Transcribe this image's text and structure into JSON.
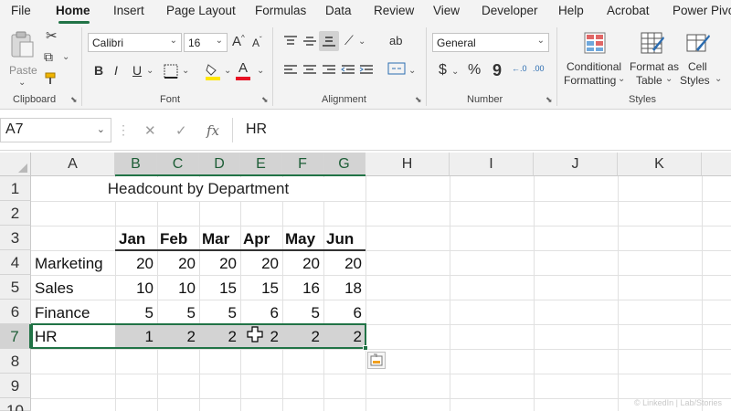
{
  "ribbon_tabs": [
    {
      "label": "File"
    },
    {
      "label": "Home"
    },
    {
      "label": "Insert"
    },
    {
      "label": "Page Layout"
    },
    {
      "label": "Formulas"
    },
    {
      "label": "Data"
    },
    {
      "label": "Review"
    },
    {
      "label": "View"
    },
    {
      "label": "Developer"
    },
    {
      "label": "Help"
    },
    {
      "label": "Acrobat"
    },
    {
      "label": "Power Pivot"
    }
  ],
  "active_tab": "Home",
  "clipboard": {
    "paste_label": "Paste",
    "group_label": "Clipboard"
  },
  "font": {
    "name": "Calibri",
    "size": "16",
    "group_label": "Font",
    "bold": "B",
    "italic": "I",
    "underline": "U",
    "grow": "A",
    "shrink": "A",
    "font_color_glyph": "A",
    "highlight_color": "#ffe600",
    "font_color": "#e81123"
  },
  "alignment": {
    "group_label": "Alignment",
    "wrap_glyph": "ab"
  },
  "number": {
    "format": "General",
    "group_label": "Number",
    "currency": "$",
    "percent": "%",
    "comma": "9",
    "inc_dec": "←.0",
    "dec_dec": ".00"
  },
  "styles": {
    "group_label": "Styles",
    "conditional": {
      "line1": "Conditional",
      "line2": "Formatting"
    },
    "format_as": {
      "line1": "Format as",
      "line2": "Table"
    },
    "cell_styles": {
      "line1": "Cell",
      "line2": "Styles"
    }
  },
  "formula_bar": {
    "name_box": "A7",
    "formula": "HR",
    "fx": "fx"
  },
  "columns": [
    "A",
    "B",
    "C",
    "D",
    "E",
    "F",
    "G",
    "H",
    "I",
    "J",
    "K"
  ],
  "rows": [
    "1",
    "2",
    "3",
    "4",
    "5",
    "6",
    "7",
    "8",
    "9",
    "10"
  ],
  "sheet": {
    "title": "Headcount by Department",
    "months": [
      "Jan",
      "Feb",
      "Mar",
      "Apr",
      "May",
      "Jun"
    ],
    "departments": [
      {
        "name": "Marketing",
        "values": [
          "20",
          "20",
          "20",
          "20",
          "20",
          "20"
        ]
      },
      {
        "name": "Sales",
        "values": [
          "10",
          "10",
          "15",
          "15",
          "16",
          "18"
        ]
      },
      {
        "name": "Finance",
        "values": [
          "5",
          "5",
          "5",
          "6",
          "5",
          "6"
        ]
      },
      {
        "name": "HR",
        "values": [
          "1",
          "2",
          "2",
          "2",
          "2",
          "2"
        ]
      }
    ]
  },
  "colors": {
    "excel_green": "#217346",
    "selection_gray": "#d3d3d3"
  },
  "watermark": "© LinkedIn | Lab/Stories"
}
